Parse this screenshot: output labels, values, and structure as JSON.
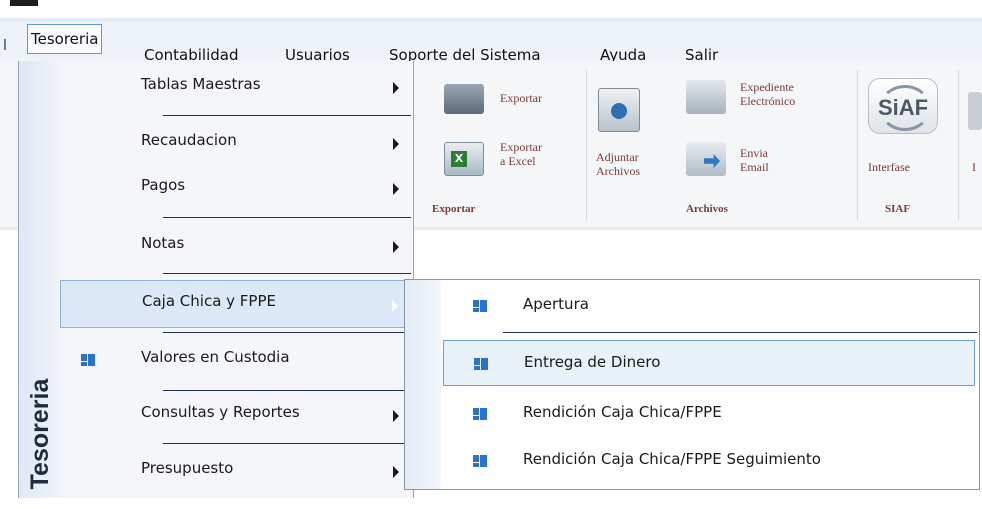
{
  "menubar": {
    "left_mark": "l",
    "items": [
      {
        "label": "Tesoreria",
        "active": true
      },
      {
        "label": "Contabilidad"
      },
      {
        "label": "Usuarios"
      },
      {
        "label": "Soporte del Sistema"
      },
      {
        "label": "Ayuda"
      },
      {
        "label": "Salir"
      }
    ]
  },
  "ribbon": {
    "exportar": "Exportar",
    "exportar_excel_line1": "Exportar",
    "exportar_excel_line2": "a Excel",
    "adjuntar_line1": "Adjuntar",
    "adjuntar_line2": "Archivos",
    "expediente_line1": "Expediente",
    "expediente_line2": "Electrónico",
    "envia_line1": "Envia",
    "envia_line2": "Email",
    "interfase": "Interfase",
    "group_exportar": "Exportar",
    "group_archivos": "Archivos",
    "group_siaf": "SIAF",
    "siaf_logo": "SiAF",
    "cut_label": "I"
  },
  "dropdown": {
    "sidebar_title": "Tesoreria",
    "items": [
      {
        "label": "Tablas Maestras",
        "submenu": true
      },
      {
        "label": "Recaudacion",
        "submenu": true
      },
      {
        "label": "Pagos",
        "submenu": true
      },
      {
        "label": "Notas",
        "submenu": true
      },
      {
        "label": "Caja Chica y FPPE",
        "submenu": true,
        "highlighted": true
      },
      {
        "label": "Valores en Custodia",
        "submenu": false
      },
      {
        "label": "Consultas y Reportes",
        "submenu": true
      },
      {
        "label": "Presupuesto",
        "submenu": true
      }
    ]
  },
  "submenu": {
    "items": [
      {
        "label": "Apertura"
      },
      {
        "label": "Entrega de Dinero",
        "highlighted": true
      },
      {
        "label": "Rendición Caja Chica/FPPE"
      },
      {
        "label": "Rendición Caja Chica/FPPE Seguimiento"
      }
    ]
  },
  "colors": {
    "accent_border": "#5a9bd5",
    "separator": "#1f2f5c",
    "icon_blue": "#2a73c9",
    "ribbon_text": "#7a3b3b"
  }
}
